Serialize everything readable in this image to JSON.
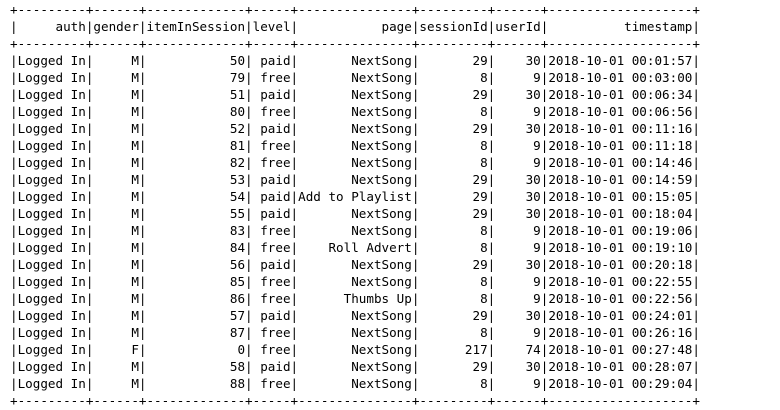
{
  "table": {
    "columns": [
      "auth",
      "gender",
      "itemInSession",
      "level",
      "page",
      "sessionId",
      "userId",
      "timestamp"
    ],
    "rows": [
      [
        "Logged In",
        "M",
        "50",
        "paid",
        "NextSong",
        "29",
        "30",
        "2018-10-01 00:01:57"
      ],
      [
        "Logged In",
        "M",
        "79",
        "free",
        "NextSong",
        "8",
        "9",
        "2018-10-01 00:03:00"
      ],
      [
        "Logged In",
        "M",
        "51",
        "paid",
        "NextSong",
        "29",
        "30",
        "2018-10-01 00:06:34"
      ],
      [
        "Logged In",
        "M",
        "80",
        "free",
        "NextSong",
        "8",
        "9",
        "2018-10-01 00:06:56"
      ],
      [
        "Logged In",
        "M",
        "52",
        "paid",
        "NextSong",
        "29",
        "30",
        "2018-10-01 00:11:16"
      ],
      [
        "Logged In",
        "M",
        "81",
        "free",
        "NextSong",
        "8",
        "9",
        "2018-10-01 00:11:18"
      ],
      [
        "Logged In",
        "M",
        "82",
        "free",
        "NextSong",
        "8",
        "9",
        "2018-10-01 00:14:46"
      ],
      [
        "Logged In",
        "M",
        "53",
        "paid",
        "NextSong",
        "29",
        "30",
        "2018-10-01 00:14:59"
      ],
      [
        "Logged In",
        "M",
        "54",
        "paid",
        "Add to Playlist",
        "29",
        "30",
        "2018-10-01 00:15:05"
      ],
      [
        "Logged In",
        "M",
        "55",
        "paid",
        "NextSong",
        "29",
        "30",
        "2018-10-01 00:18:04"
      ],
      [
        "Logged In",
        "M",
        "83",
        "free",
        "NextSong",
        "8",
        "9",
        "2018-10-01 00:19:06"
      ],
      [
        "Logged In",
        "M",
        "84",
        "free",
        "Roll Advert",
        "8",
        "9",
        "2018-10-01 00:19:10"
      ],
      [
        "Logged In",
        "M",
        "56",
        "paid",
        "NextSong",
        "29",
        "30",
        "2018-10-01 00:20:18"
      ],
      [
        "Logged In",
        "M",
        "85",
        "free",
        "NextSong",
        "8",
        "9",
        "2018-10-01 00:22:55"
      ],
      [
        "Logged In",
        "M",
        "86",
        "free",
        "Thumbs Up",
        "8",
        "9",
        "2018-10-01 00:22:56"
      ],
      [
        "Logged In",
        "M",
        "57",
        "paid",
        "NextSong",
        "29",
        "30",
        "2018-10-01 00:24:01"
      ],
      [
        "Logged In",
        "M",
        "87",
        "free",
        "NextSong",
        "8",
        "9",
        "2018-10-01 00:26:16"
      ],
      [
        "Logged In",
        "F",
        "0",
        "free",
        "NextSong",
        "217",
        "74",
        "2018-10-01 00:27:48"
      ],
      [
        "Logged In",
        "M",
        "58",
        "paid",
        "NextSong",
        "29",
        "30",
        "2018-10-01 00:28:07"
      ],
      [
        "Logged In",
        "M",
        "88",
        "free",
        "NextSong",
        "8",
        "9",
        "2018-10-01 00:29:04"
      ]
    ]
  }
}
